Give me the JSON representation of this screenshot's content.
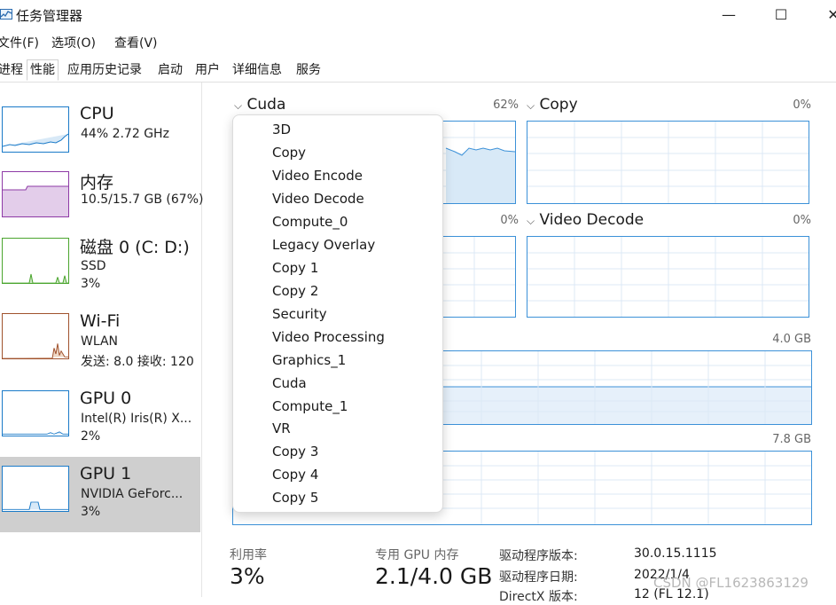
{
  "window": {
    "title": "任务管理器",
    "controls": {
      "minimize": "—",
      "maximize": "☐",
      "close": "✕"
    }
  },
  "menu": {
    "file": "文件(F)",
    "options": "选项(O)",
    "view": "查看(V)"
  },
  "tabs": {
    "processes": "进程",
    "performance": "性能",
    "app_history": "应用历史记录",
    "startup": "启动",
    "users": "用户",
    "details": "详细信息",
    "services": "服务"
  },
  "sidebar": {
    "cpu": {
      "name": "CPU",
      "sub1": "44%  2.72 GHz",
      "color": "#1a7ac8"
    },
    "memory": {
      "name": "内存",
      "sub1": "10.5/15.7 GB (67%)",
      "color": "#8e3aa6"
    },
    "disk": {
      "name": "磁盘 0 (C: D:)",
      "sub1": "SSD",
      "sub2": "3%",
      "color": "#4aa52e"
    },
    "wifi": {
      "name": "Wi-Fi",
      "sub1": "WLAN",
      "sub2": "发送: 8.0  接收: 120",
      "color": "#a0522d"
    },
    "gpu0": {
      "name": "GPU 0",
      "sub1": "Intel(R) Iris(R) X...",
      "sub2": "2%",
      "color": "#1a7ac8"
    },
    "gpu1": {
      "name": "GPU 1",
      "sub1": "NVIDIA GeForc...",
      "sub2": "3%",
      "color": "#1a7ac8"
    }
  },
  "panels": {
    "cuda": {
      "title": "Cuda",
      "pct": "62%"
    },
    "copy": {
      "title": "Copy",
      "pct": "0%"
    },
    "left2": {
      "pct": "0%"
    },
    "video_decode": {
      "title": "Video Decode",
      "pct": "0%"
    },
    "dedicated_max": "4.0 GB",
    "shared_max": "7.8 GB"
  },
  "dropdown": {
    "items": [
      "3D",
      "Copy",
      "Video Encode",
      "Video Decode",
      "Compute_0",
      "Legacy Overlay",
      "Copy 1",
      "Copy 2",
      "Security",
      "Video Processing",
      "Graphics_1",
      "Cuda",
      "Compute_1",
      "VR",
      "Copy 3",
      "Copy 4",
      "Copy 5"
    ]
  },
  "stats": {
    "utilization_label": "利用率",
    "utilization_value": "3%",
    "dedicated_label": "专用 GPU 内存",
    "dedicated_value": "2.1/4.0 GB",
    "driver_version_label": "驱动程序版本:",
    "driver_version_value": "30.0.15.1115",
    "driver_date_label": "驱动程序日期:",
    "driver_date_value": "2022/1/4",
    "directx_label": "DirectX 版本:",
    "directx_value": "12 (FL 12.1)"
  },
  "watermark": "CSDN @FL1623863129",
  "colors": {
    "gpu_blue": "#3c91d8",
    "selected_bg": "#cfcfcf"
  }
}
